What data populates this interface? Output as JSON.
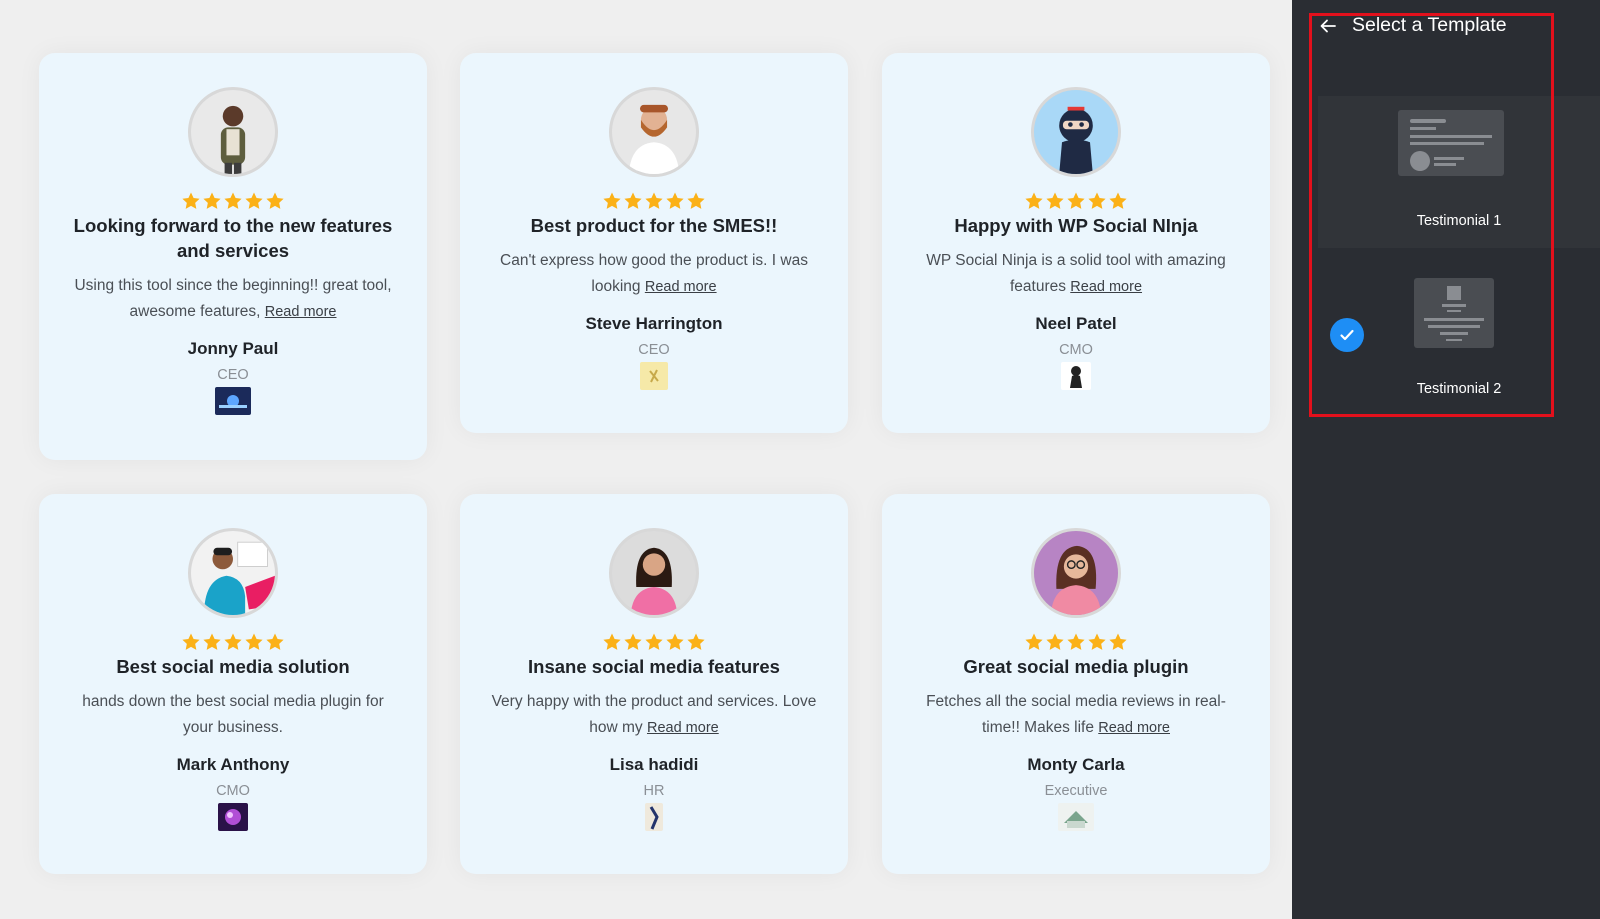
{
  "cards": [
    {
      "title": "Looking forward to the new features and services",
      "text": "Using this tool since the beginning!! great tool, awesome features, ",
      "read_more": "Read more",
      "name": "Jonny Paul",
      "role": "CEO",
      "rating": 5
    },
    {
      "title": "Best product for the SMES!!",
      "text": "Can't express how good the product is. I was looking ",
      "read_more": "Read more",
      "name": "Steve Harrington",
      "role": "CEO",
      "rating": 5
    },
    {
      "title": "Happy with WP Social NInja",
      "text": "WP Social Ninja is a solid tool with amazing features ",
      "read_more": "Read more",
      "name": "Neel Patel",
      "role": "CMO",
      "rating": 5
    },
    {
      "title": "Best social media solution",
      "text": "hands down the best social media plugin for your business.",
      "read_more": "",
      "name": "Mark Anthony",
      "role": "CMO",
      "rating": 5
    },
    {
      "title": "Insane social media features",
      "text": "Very happy with the product and services. Love how my ",
      "read_more": "Read more",
      "name": "Lisa hadidi",
      "role": "HR",
      "rating": 5
    },
    {
      "title": "Great social media plugin",
      "text": "Fetches all the social media reviews in real-time!! Makes life ",
      "read_more": "Read more",
      "name": "Monty Carla",
      "role": "Executive",
      "rating": 5
    }
  ],
  "panel": {
    "title": "Select a Template",
    "templates": [
      {
        "label": "Testimonial 1",
        "selected": false
      },
      {
        "label": "Testimonial 2",
        "selected": true
      }
    ]
  },
  "colors": {
    "star": "#fbb117",
    "card_bg": "#ebf6fd",
    "panel_bg": "#2a2d33",
    "check": "#1e8ef5",
    "highlight": "#e3101c"
  },
  "icons": {
    "back": "arrow-left-icon",
    "check": "checkmark-icon",
    "star": "star-icon"
  }
}
